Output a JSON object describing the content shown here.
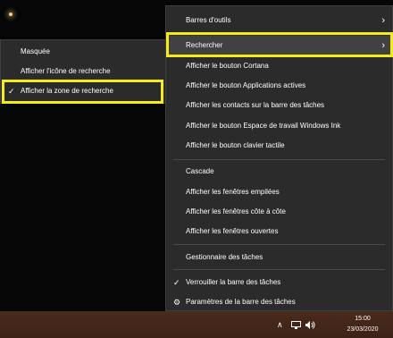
{
  "main_menu": {
    "items": [
      {
        "label": "Barres d'outils",
        "has_submenu": true
      },
      {
        "label": "Rechercher",
        "has_submenu": true
      },
      {
        "label": "Afficher le bouton Cortana"
      },
      {
        "label": "Afficher le bouton Applications actives"
      },
      {
        "label": "Afficher les contacts sur la barre des tâches"
      },
      {
        "label": "Afficher le bouton Espace de travail Windows Ink"
      },
      {
        "label": "Afficher le bouton clavier tactile"
      },
      {
        "label": "Cascade"
      },
      {
        "label": "Afficher les fenêtres empilées"
      },
      {
        "label": "Afficher les fenêtres côte à côte"
      },
      {
        "label": "Afficher les fenêtres ouvertes"
      },
      {
        "label": "Gestionnaire des tâches"
      },
      {
        "label": "Verrouiller la barre des tâches",
        "checked": true
      },
      {
        "label": "Paramètres de la barre des tâches",
        "icon": "gear-icon"
      }
    ]
  },
  "search_submenu": {
    "items": [
      {
        "label": "Masquée"
      },
      {
        "label": "Afficher l'icône de recherche"
      },
      {
        "label": "Afficher la zone de recherche",
        "checked": true
      }
    ]
  },
  "glyphs": {
    "chevron": "›",
    "check": "✓",
    "gear": "⚙",
    "tray_up": "∧"
  },
  "taskbar": {
    "time": "15:00",
    "date": "23/03/2020"
  },
  "colors": {
    "menu_bg": "#2b2b2b",
    "highlight": "#f5eb1c",
    "taskbar": "#3d2317"
  }
}
